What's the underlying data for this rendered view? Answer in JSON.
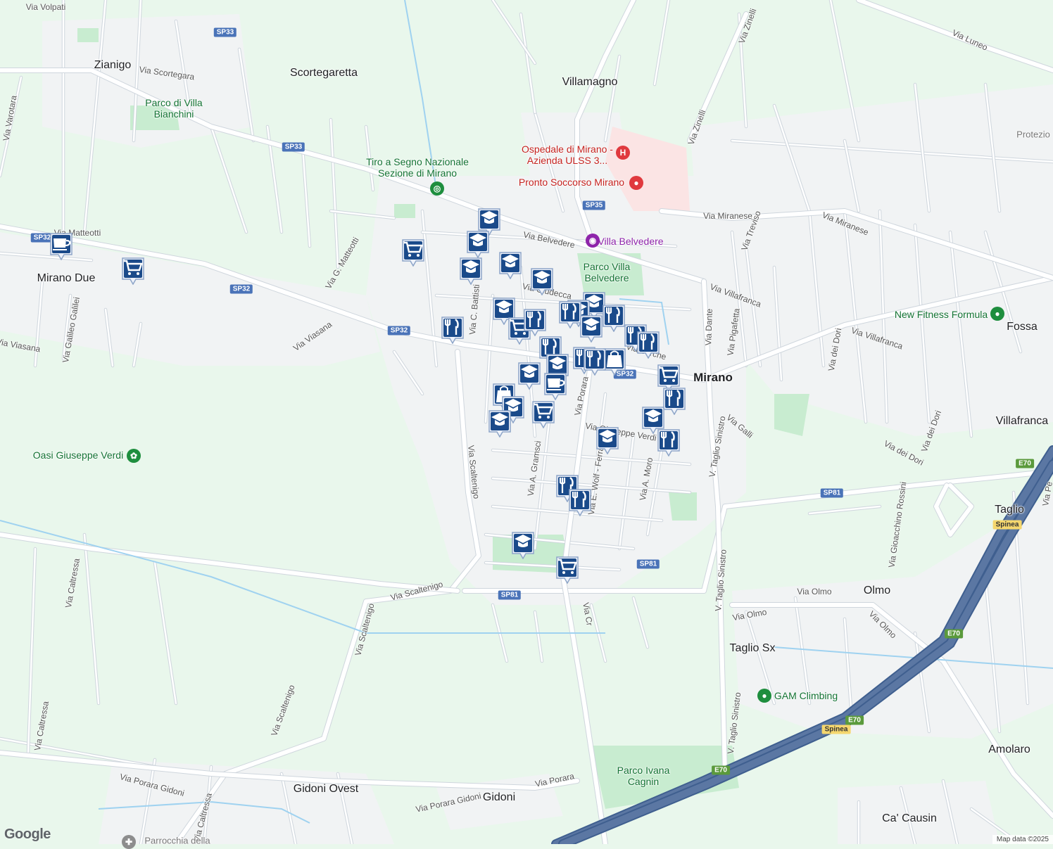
{
  "map": {
    "colors": {
      "land": "#e9f7ec",
      "urban": "#f1f3f4",
      "park": "#c8ecd0",
      "road": "#ffffff",
      "road_edge": "#cfd6dd",
      "highway": "#5b77a3",
      "hospital_area": "#fbe4e4",
      "marker": "#1a4a8a"
    },
    "towns": [
      "Zianigo",
      "Scortegaretta",
      "Villamagno",
      "Mirano Due",
      "Mirano",
      "Fossa",
      "Villafranca",
      "Taglio",
      "Olmo",
      "Taglio Sx",
      "Amolaro",
      "Gidoni Ovest",
      "Gidoni",
      "Ca' Causin"
    ],
    "streets": [
      "Via Volpati",
      "Via Scortegara",
      "Via Varotara",
      "Via Matteotti",
      "Via Galileo Galilei",
      "Via Viasana",
      "Via Viasana",
      "Via G. Matteotti",
      "Via C. Battisti",
      "Via Belvedere",
      "Via Giudecca",
      "Via Barche",
      "Via Porara",
      "Via Scaltenigo",
      "Via A. Gramsci",
      "Via E. Wolf - Ferrari",
      "Via A. Moro",
      "Via Giuseppe Verdi",
      "Via Dante",
      "V. Taglio Sinistro",
      "V. Taglio Sinistro",
      "V. Taglio Sinistro",
      "Via Miranese",
      "Via Miranese",
      "Via Villafranca",
      "Via Villafranca",
      "Via Pigafetta",
      "Via dei Dori",
      "Via dei Dori",
      "Via dei Dori",
      "Via Galli",
      "Via Treviso",
      "Via Zinelli",
      "Via Zinelli",
      "Via Luneo",
      "Via Olmo",
      "Via Olmo",
      "Via Olmo",
      "Via Gioacchino Rossini",
      "Via Scaltenigo",
      "Via Scaltenigo",
      "Via Scaltenigo",
      "Via Caltressa",
      "Via Caltressa",
      "Via Caltressa",
      "Via Porara Gidoni",
      "Via Porara Gidoni",
      "Via Porara",
      "Via Cr",
      "Via Pe"
    ],
    "parks": [
      "Parco di Villa Bianchini",
      "Parco Villa Belvedere",
      "Parco Ivana Cagnin"
    ],
    "pois": {
      "hospital": "Ospedale di Mirano - Azienda ULSS 3...",
      "emergency": "Pronto Soccorso Mirano",
      "shooting": "Tiro a Segno Nazionale Sezione di Mirano",
      "villa": "Villa Belvedere",
      "fitness": "New Fitness Formula",
      "oasis": "Oasi Giuseppe Verdi",
      "climbing": "GAM Climbing",
      "protezione": "Protezio",
      "parrocchia": "Parrocchia della"
    },
    "shields": [
      "SP33",
      "SP33",
      "SP32",
      "SP32",
      "SP32",
      "SP32",
      "SP35",
      "SP81",
      "SP81",
      "SP81",
      "E70",
      "E70",
      "E70",
      "E70",
      "Spinea",
      "Spinea"
    ],
    "markers": [
      {
        "type": "cafe-icon"
      },
      {
        "type": "cart-icon"
      },
      {
        "type": "cart-icon"
      },
      {
        "type": "school-icon"
      },
      {
        "type": "school-icon"
      },
      {
        "type": "school-icon"
      },
      {
        "type": "school-icon"
      },
      {
        "type": "school-icon"
      },
      {
        "type": "school-icon"
      },
      {
        "type": "restaurant-icon"
      },
      {
        "type": "cart-icon"
      },
      {
        "type": "restaurant-icon"
      },
      {
        "type": "school-icon"
      },
      {
        "type": "school-icon"
      },
      {
        "type": "restaurant-icon"
      },
      {
        "type": "restaurant-icon"
      },
      {
        "type": "school-icon"
      },
      {
        "type": "restaurant-icon"
      },
      {
        "type": "restaurant-icon"
      },
      {
        "type": "restaurant-icon"
      },
      {
        "type": "restaurant-icon"
      },
      {
        "type": "bag-icon"
      },
      {
        "type": "restaurant-icon"
      },
      {
        "type": "school-icon"
      },
      {
        "type": "cafe-icon"
      },
      {
        "type": "bag-icon"
      },
      {
        "type": "school-icon"
      },
      {
        "type": "school-icon"
      },
      {
        "type": "cart-icon"
      },
      {
        "type": "cart-icon"
      },
      {
        "type": "restaurant-icon"
      },
      {
        "type": "school-icon"
      },
      {
        "type": "restaurant-icon"
      },
      {
        "type": "school-icon"
      },
      {
        "type": "restaurant-icon"
      },
      {
        "type": "restaurant-icon"
      },
      {
        "type": "school-icon"
      },
      {
        "type": "cart-icon"
      },
      {
        "type": "school-icon"
      }
    ],
    "google": "Google",
    "attribution": "Map data ©2025"
  }
}
